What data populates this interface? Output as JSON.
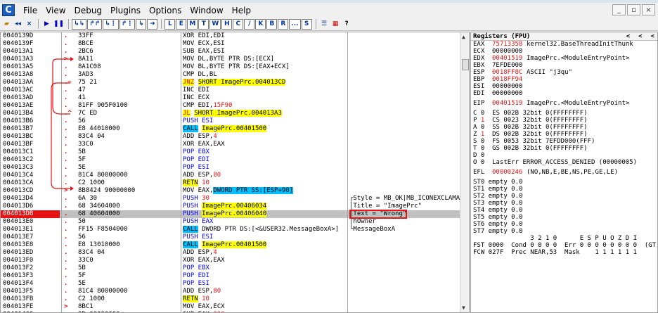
{
  "menu": {
    "app_icon": "C",
    "items": [
      "File",
      "View",
      "Debug",
      "Plugins",
      "Options",
      "Window",
      "Help"
    ],
    "win_buttons": [
      "_",
      "▫",
      "×"
    ]
  },
  "toolbar": {
    "buttons": [
      "▸",
      "◂◂",
      "×",
      "▶",
      "❚❚",
      "↳↳",
      "↱↱",
      "↳⋮",
      "↱⋮",
      "↳",
      "➜"
    ],
    "letters": [
      "L",
      "E",
      "M",
      "T",
      "W",
      "H",
      "C",
      "/",
      "K",
      "B",
      "R",
      "...",
      "S"
    ],
    "extra": [
      "☰",
      "▦",
      "?"
    ]
  },
  "cpu": {
    "rows": [
      {
        "addr": "0040139D",
        "mk": ".",
        "hex": "33FF",
        "dis": [
          {
            "t": "XOR EDI,EDI"
          }
        ],
        "cmt": ""
      },
      {
        "addr": "0040139F",
        "mk": ".",
        "hex": "8BCE",
        "dis": [
          {
            "t": "MOV ECX,ESI"
          }
        ],
        "cmt": ""
      },
      {
        "addr": "004013A1",
        "mk": ".",
        "hex": "2BC6",
        "dis": [
          {
            "t": "SUB EAX,ESI"
          }
        ],
        "cmt": ""
      },
      {
        "addr": "004013A3",
        "mk": ">",
        "hex": "8A11",
        "dis": [
          {
            "t": "MOV DL,BYTE PTR DS:[ECX]"
          }
        ],
        "cmt": ""
      },
      {
        "addr": "004013A5",
        "mk": ".",
        "hex": "8A1C08",
        "dis": [
          {
            "t": "MOV BL,BYTE PTR DS:[EAX+ECX]"
          }
        ],
        "cmt": ""
      },
      {
        "addr": "004013A8",
        "mk": ".",
        "hex": "3AD3",
        "dis": [
          {
            "t": "CMP DL,BL"
          }
        ],
        "cmt": ""
      },
      {
        "addr": "004013AA",
        "mk": ".~",
        "hex": "75 21",
        "dis": [
          {
            "t": "JNZ",
            "c": "hl-jmpyellow"
          },
          {
            "t": " "
          },
          {
            "t": "SHORT ImagePrc.004013CD",
            "c": "hl-yellow"
          }
        ],
        "cmt": ""
      },
      {
        "addr": "004013AC",
        "mk": ".",
        "hex": "47",
        "dis": [
          {
            "t": "INC EDI"
          }
        ],
        "cmt": ""
      },
      {
        "addr": "004013AD",
        "mk": ".",
        "hex": "41",
        "dis": [
          {
            "t": "INC ECX"
          }
        ],
        "cmt": ""
      },
      {
        "addr": "004013AE",
        "mk": ".",
        "hex": "81FF 905F0100",
        "dis": [
          {
            "t": "CMP EDI,"
          },
          {
            "t": "15F90",
            "c": "hl-red"
          }
        ],
        "cmt": ""
      },
      {
        "addr": "004013B4",
        "mk": ".^",
        "hex": "7C ED",
        "dis": [
          {
            "t": "JL",
            "c": "hl-jmpyellow"
          },
          {
            "t": " "
          },
          {
            "t": "SHORT ImagePrc.004013A3",
            "c": "hl-yellow"
          }
        ],
        "cmt": ""
      },
      {
        "addr": "004013B6",
        "mk": ".",
        "hex": "56",
        "dis": [
          {
            "t": "PUSH ESI",
            "c": "hl-blue-txt"
          }
        ],
        "cmt": ""
      },
      {
        "addr": "004013B7",
        "mk": ".",
        "hex": "E8 44010000",
        "dis": [
          {
            "t": "CALL",
            "c": "hl-blue"
          },
          {
            "t": " "
          },
          {
            "t": "ImagePrc.00401500",
            "c": "hl-yellow"
          }
        ],
        "cmt": ""
      },
      {
        "addr": "004013BC",
        "mk": ".",
        "hex": "83C4 04",
        "dis": [
          {
            "t": "ADD ESP,"
          },
          {
            "t": "4",
            "c": "hl-red"
          }
        ],
        "cmt": ""
      },
      {
        "addr": "004013BF",
        "mk": ".",
        "hex": "33C0",
        "dis": [
          {
            "t": "XOR EAX,EAX"
          }
        ],
        "cmt": ""
      },
      {
        "addr": "004013C1",
        "mk": ".",
        "hex": "5B",
        "dis": [
          {
            "t": "POP EBX",
            "c": "hl-blue-txt"
          }
        ],
        "cmt": ""
      },
      {
        "addr": "004013C2",
        "mk": ".",
        "hex": "5F",
        "dis": [
          {
            "t": "POP EDI",
            "c": "hl-blue-txt"
          }
        ],
        "cmt": ""
      },
      {
        "addr": "004013C3",
        "mk": ".",
        "hex": "5E",
        "dis": [
          {
            "t": "POP ESI",
            "c": "hl-blue-txt"
          }
        ],
        "cmt": ""
      },
      {
        "addr": "004013C4",
        "mk": ".",
        "hex": "81C4 80000000",
        "dis": [
          {
            "t": "ADD ESP,"
          },
          {
            "t": "80",
            "c": "hl-red"
          }
        ],
        "cmt": ""
      },
      {
        "addr": "004013CA",
        "mk": ".",
        "hex": "C2 1000",
        "dis": [
          {
            "t": "RETN",
            "c": "hl-yellow"
          },
          {
            "t": " "
          },
          {
            "t": "10",
            "c": "hl-red"
          }
        ],
        "cmt": ""
      },
      {
        "addr": "004013CD",
        "mk": ">",
        "hex": "8B8424 90000000",
        "dis": [
          {
            "t": "MOV EAX,"
          },
          {
            "t": "DWORD PTR SS:[ESP+90]",
            "c": "hl-blue"
          }
        ],
        "cmt": ""
      },
      {
        "addr": "004013D4",
        "mk": ".",
        "hex": "6A 30",
        "dis": [
          {
            "t": "PUSH ",
            "c": "hl-blue-txt"
          },
          {
            "t": "30",
            "c": "hl-red"
          }
        ],
        "cmt": "┌Style = MB_OK|MB_ICONEXCLAMAT"
      },
      {
        "addr": "004013D6",
        "mk": ".",
        "hex": "68 34604000",
        "dis": [
          {
            "t": "PUSH ",
            "c": "hl-blue-txt"
          },
          {
            "t": "ImagePrc.00406034",
            "c": "hl-yellow"
          }
        ],
        "cmt": "│Title = \"ImagePrc\""
      },
      {
        "addr": "004013DB",
        "mk": ".",
        "hex": "68 40604000",
        "dis": [
          {
            "t": "PUSH ",
            "c": "hl-blue-txt"
          },
          {
            "t": "ImagePrc.00406040",
            "c": "hl-yellow"
          }
        ],
        "cmt": "│Text = \"Wrong\"",
        "sel": true,
        "cur": true
      },
      {
        "addr": "004013E0",
        "mk": ".",
        "hex": "50",
        "dis": [
          {
            "t": "PUSH EAX",
            "c": "hl-blue-txt"
          }
        ],
        "cmt": "│hOwner"
      },
      {
        "addr": "004013E1",
        "mk": ".",
        "hex": "FF15 F8504000",
        "dis": [
          {
            "t": "CALL",
            "c": "hl-blue"
          },
          {
            "t": " DWORD PTR DS:[<&USER32.MessageBoxA>]"
          }
        ],
        "cmt": "└MessageBoxA"
      },
      {
        "addr": "004013E7",
        "mk": ".",
        "hex": "56",
        "dis": [
          {
            "t": "PUSH ESI",
            "c": "hl-blue-txt"
          }
        ],
        "cmt": ""
      },
      {
        "addr": "004013E8",
        "mk": ".",
        "hex": "E8 13010000",
        "dis": [
          {
            "t": "CALL",
            "c": "hl-blue"
          },
          {
            "t": " "
          },
          {
            "t": "ImagePrc.00401500",
            "c": "hl-yellow"
          }
        ],
        "cmt": ""
      },
      {
        "addr": "004013ED",
        "mk": ".",
        "hex": "83C4 04",
        "dis": [
          {
            "t": "ADD ESP,"
          },
          {
            "t": "4",
            "c": "hl-red"
          }
        ],
        "cmt": ""
      },
      {
        "addr": "004013F0",
        "mk": ".",
        "hex": "33C0",
        "dis": [
          {
            "t": "XOR EAX,EAX"
          }
        ],
        "cmt": ""
      },
      {
        "addr": "004013F2",
        "mk": ".",
        "hex": "5B",
        "dis": [
          {
            "t": "POP EBX",
            "c": "hl-blue-txt"
          }
        ],
        "cmt": ""
      },
      {
        "addr": "004013F3",
        "mk": ".",
        "hex": "5F",
        "dis": [
          {
            "t": "POP EDI",
            "c": "hl-blue-txt"
          }
        ],
        "cmt": ""
      },
      {
        "addr": "004013F4",
        "mk": ".",
        "hex": "5E",
        "dis": [
          {
            "t": "POP ESI",
            "c": "hl-blue-txt"
          }
        ],
        "cmt": ""
      },
      {
        "addr": "004013F5",
        "mk": ".",
        "hex": "81C4 80000000",
        "dis": [
          {
            "t": "ADD ESP,"
          },
          {
            "t": "80",
            "c": "hl-red"
          }
        ],
        "cmt": ""
      },
      {
        "addr": "004013FB",
        "mk": ".",
        "hex": "C2 1000",
        "dis": [
          {
            "t": "RETN",
            "c": "hl-yellow"
          },
          {
            "t": " "
          },
          {
            "t": "10",
            "c": "hl-red"
          }
        ],
        "cmt": ""
      },
      {
        "addr": "004013FE",
        "mk": ">",
        "hex": "8BC1",
        "dis": [
          {
            "t": "MOV EAX,ECX"
          }
        ],
        "cmt": ""
      },
      {
        "addr": "00401400",
        "mk": ".",
        "hex": "2D 00020000",
        "dis": [
          {
            "t": "SUB EAX,"
          },
          {
            "t": "200",
            "c": "hl-red"
          }
        ],
        "cmt": ""
      }
    ]
  },
  "registers": {
    "title": "Registers (FPU)",
    "nav": [
      "<",
      "<",
      "<"
    ],
    "lines": [
      {
        "k": "EAX",
        "v": "75713358",
        "red": true,
        "c": "kernel32.BaseThreadInitThunk"
      },
      {
        "k": "ECX",
        "v": "00000000",
        "red": false,
        "c": ""
      },
      {
        "k": "EDX",
        "v": "00401519",
        "red": true,
        "c": "ImagePrc.<ModuleEntryPoint>"
      },
      {
        "k": "EBX",
        "v": "7EFDE000",
        "red": false,
        "c": ""
      },
      {
        "k": "ESP",
        "v": "0018FF8C",
        "red": true,
        "c": "ASCII \"j3qu\""
      },
      {
        "k": "EBP",
        "v": "0018FF94",
        "red": true,
        "c": ""
      },
      {
        "k": "ESI",
        "v": "00000000",
        "red": false,
        "c": ""
      },
      {
        "k": "EDI",
        "v": "00000000",
        "red": false,
        "c": ""
      },
      {
        "gap": true
      },
      {
        "k": "EIP",
        "v": "00401519",
        "red": true,
        "c": "ImagePrc.<ModuleEntryPoint>"
      },
      {
        "gap": true
      },
      {
        "raw": "C 0  ES 002B 32bit 0(FFFFFFFF)"
      },
      {
        "raw": "P 1  CS 0023 32bit 0(FFFFFFFF)",
        "redflag": true
      },
      {
        "raw": "A 0  SS 002B 32bit 0(FFFFFFFF)"
      },
      {
        "raw": "Z 1  DS 002B 32bit 0(FFFFFFFF)",
        "redflag": true
      },
      {
        "raw": "S 0  FS 0053 32bit 7EFDD000(FFF)"
      },
      {
        "raw": "T 0  GS 002B 32bit 0(FFFFFFFF)"
      },
      {
        "raw": "D 0"
      },
      {
        "raw": "O 0  LastErr ERROR_ACCESS_DENIED (00000005)"
      },
      {
        "gap": true
      },
      {
        "k": "EFL",
        "v": "00000246",
        "red": true,
        "c": "(NO,NB,E,BE,NS,PE,GE,LE)"
      },
      {
        "gap": true
      },
      {
        "raw": "ST0 empty 0.0"
      },
      {
        "raw": "ST1 empty 0.0"
      },
      {
        "raw": "ST2 empty 0.0"
      },
      {
        "raw": "ST3 empty 0.0"
      },
      {
        "raw": "ST4 empty 0.0"
      },
      {
        "raw": "ST5 empty 0.0"
      },
      {
        "raw": "ST6 empty 0.0"
      },
      {
        "raw": "ST7 empty 0.0"
      },
      {
        "raw": "               3 2 1 0      E S P U O Z D I"
      },
      {
        "raw": "FST 0000  Cond 0 0 0 0  Err 0 0 0 0 0 0 0 0  (GT)"
      },
      {
        "raw": "FCW 027F  Prec NEAR,53  Mask    1 1 1 1 1 1"
      }
    ]
  }
}
